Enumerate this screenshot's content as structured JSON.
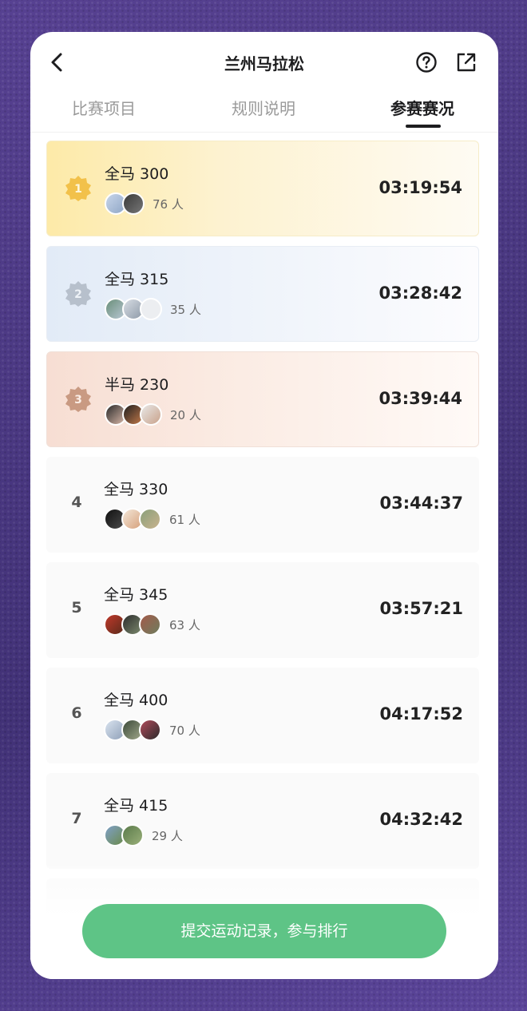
{
  "header": {
    "title": "兰州马拉松",
    "back_icon": "chevron-left-icon",
    "help_icon": "question-circle-icon",
    "share_icon": "share-external-icon"
  },
  "tabs": [
    {
      "label": "比赛项目",
      "active": false
    },
    {
      "label": "规则说明",
      "active": false
    },
    {
      "label": "参赛赛况",
      "active": true
    }
  ],
  "rows": [
    {
      "rank": "1",
      "name": "全马 300",
      "count": "76 人",
      "time": "03:19:54"
    },
    {
      "rank": "2",
      "name": "全马 315",
      "count": "35 人",
      "time": "03:28:42"
    },
    {
      "rank": "3",
      "name": "半马 230",
      "count": "20 人",
      "time": "03:39:44"
    },
    {
      "rank": "4",
      "name": "全马 330",
      "count": "61 人",
      "time": "03:44:37"
    },
    {
      "rank": "5",
      "name": "全马 345",
      "count": "63 人",
      "time": "03:57:21"
    },
    {
      "rank": "6",
      "name": "全马 400",
      "count": "70 人",
      "time": "04:17:52"
    },
    {
      "rank": "7",
      "name": "全马 415",
      "count": "29 人",
      "time": "04:32:42"
    }
  ],
  "colors": {
    "accent_green": "#5ec486",
    "gold": "#f2c14a",
    "silver": "#b7c0cc",
    "bronze": "#c99a82"
  },
  "submit": {
    "label": "提交运动记录，参与排行"
  }
}
